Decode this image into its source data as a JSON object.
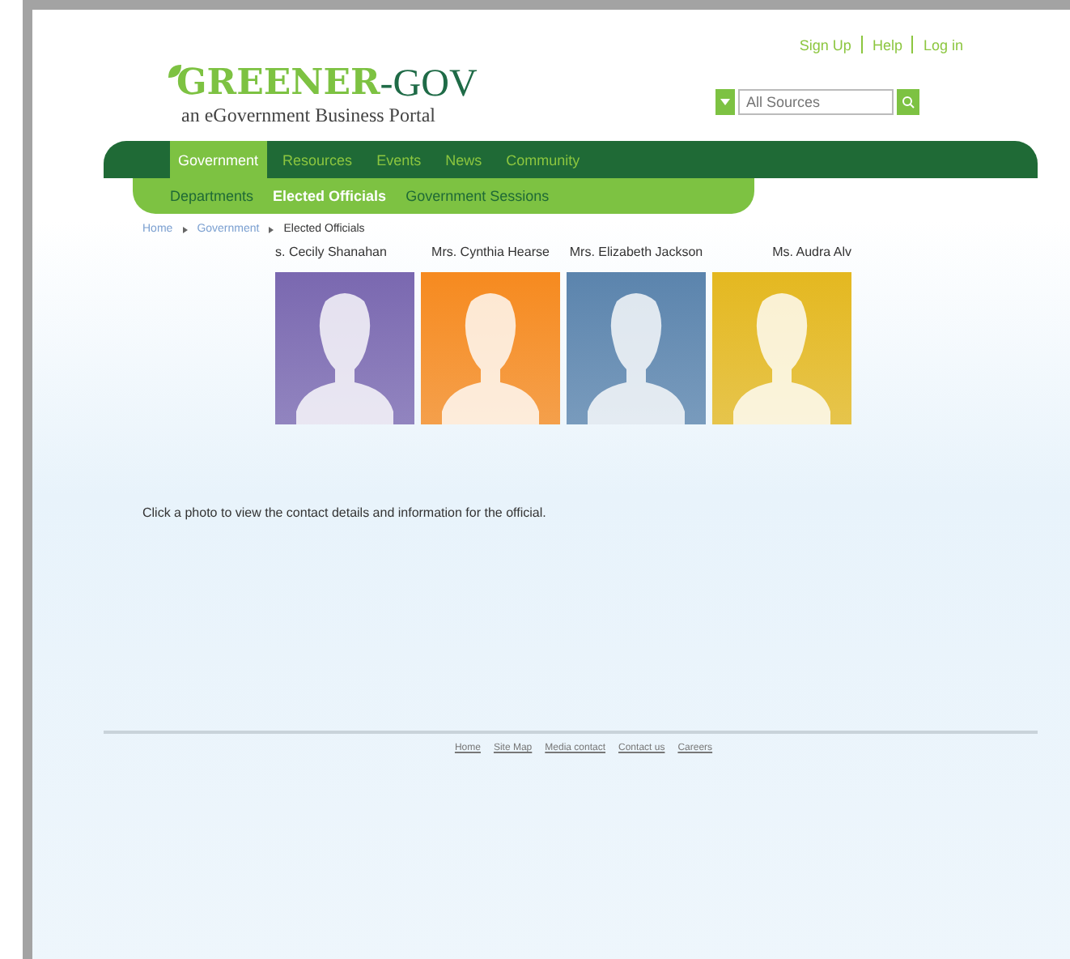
{
  "top_links": [
    "Sign Up",
    "Help",
    "Log in"
  ],
  "logo": {
    "brand_main": "GREENER",
    "brand_suffix": "-GOV",
    "tagline": "an eGovernment Business Portal"
  },
  "search": {
    "placeholder": "All Sources"
  },
  "main_nav": [
    {
      "label": "Government",
      "selected": true
    },
    {
      "label": "Resources",
      "selected": false
    },
    {
      "label": "Events",
      "selected": false
    },
    {
      "label": "News",
      "selected": false
    },
    {
      "label": "Community",
      "selected": false
    }
  ],
  "sub_nav": [
    {
      "label": "Departments",
      "selected": false
    },
    {
      "label": "Elected Officials",
      "selected": true
    },
    {
      "label": "Government Sessions",
      "selected": false
    }
  ],
  "breadcrumb": [
    {
      "label": "Home",
      "link": true
    },
    {
      "label": "Government",
      "link": true
    },
    {
      "label": "Elected Officials",
      "link": false
    }
  ],
  "officials": [
    {
      "name": "s. Cecily Shanahan",
      "color": "#7a68b0"
    },
    {
      "name": "Mrs. Cynthia Hearse",
      "color": "#f68a1f"
    },
    {
      "name": "Mrs. Elizabeth Jackson",
      "color": "#5b84ad"
    },
    {
      "name": "Ms. Audra Alv",
      "color": "#e4b820"
    }
  ],
  "instructions": "Click a photo to view the contact details and information for the official.",
  "footer_links": [
    "Home",
    "Site Map",
    "Media contact",
    "Contact us",
    "Careers"
  ]
}
